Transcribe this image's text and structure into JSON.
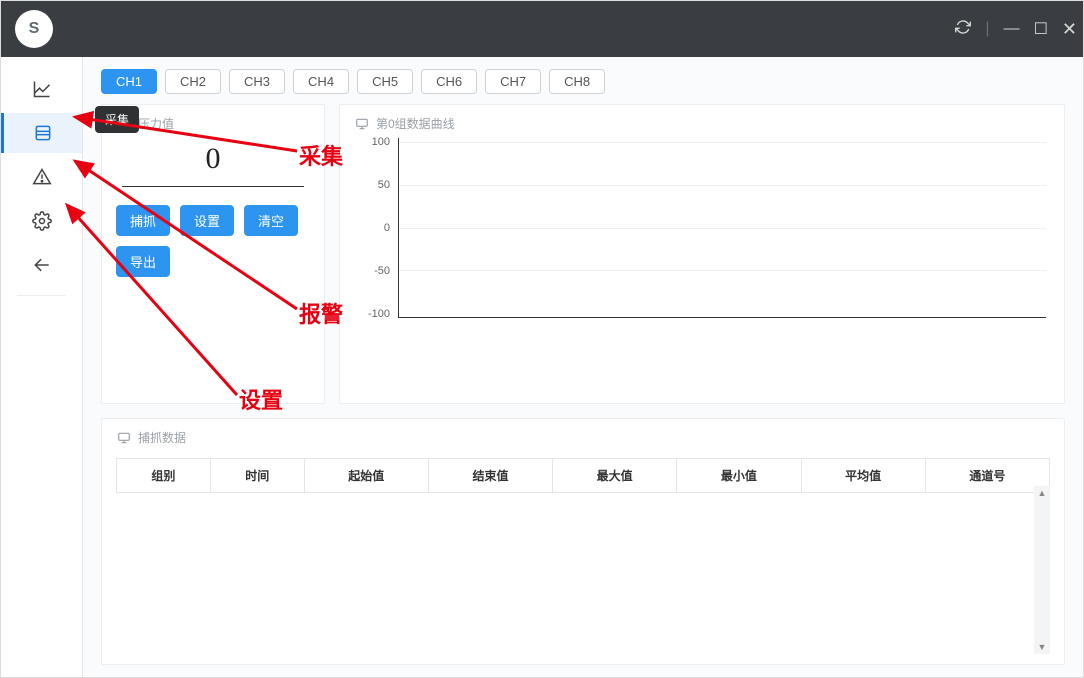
{
  "titlebar": {
    "logo_text": "S"
  },
  "sidebar": {
    "tooltip": "采集"
  },
  "channels": [
    "CH1",
    "CH2",
    "CH3",
    "CH4",
    "CH5",
    "CH6",
    "CH7",
    "CH8"
  ],
  "active_channel": 0,
  "pressure_panel": {
    "title": "压力值",
    "value": "0",
    "btn_capture": "捕抓",
    "btn_settings": "设置",
    "btn_clear": "清空",
    "btn_export": "导出"
  },
  "chart_panel": {
    "title": "第0组数据曲线"
  },
  "chart_data": {
    "type": "line",
    "title": "第0组数据曲线",
    "xlabel": "",
    "ylabel": "",
    "ylim": [
      -100,
      100
    ],
    "y_ticks": [
      100,
      50,
      0,
      -50,
      -100
    ],
    "series": []
  },
  "data_panel": {
    "title": "捕抓数据",
    "columns": [
      "组别",
      "时间",
      "起始值",
      "结束值",
      "最大值",
      "最小值",
      "平均值",
      "通道号"
    ]
  },
  "annotations": {
    "a1": "采集",
    "a2": "报警",
    "a3": "设置"
  }
}
